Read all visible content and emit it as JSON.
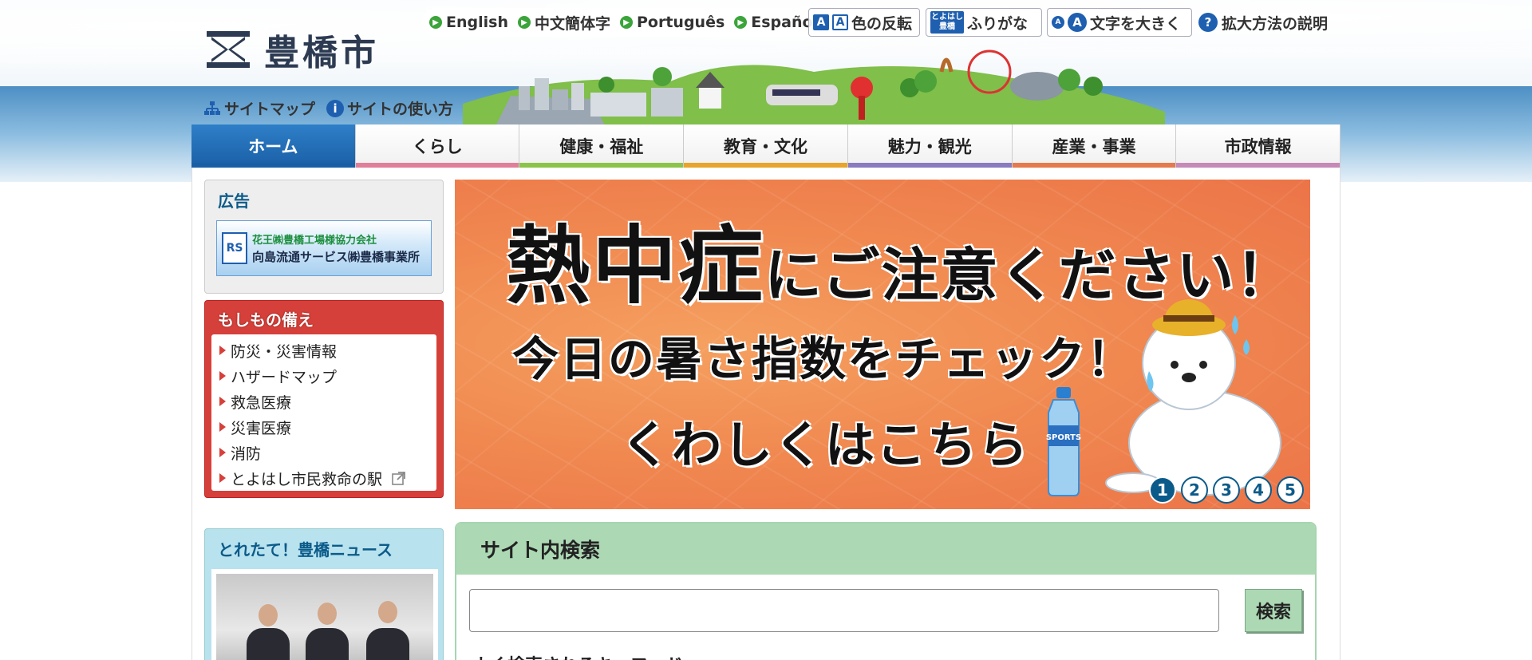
{
  "site": {
    "logo_text": "豊橋市"
  },
  "languages": [
    "English",
    "中文簡体字",
    "Português",
    "Español"
  ],
  "tools": {
    "color_invert": "色の反転",
    "furigana_badge_line1": "とよはし",
    "furigana_badge_line2": "豊橋",
    "furigana": "ふりがな",
    "text_large": "文字を大きく",
    "zoom_help": "拡大方法の説明"
  },
  "sublinks": {
    "sitemap": "サイトマップ",
    "how_to_use": "サイトの使い方"
  },
  "nav": [
    {
      "label": "ホーム",
      "color": "#1a5fa6"
    },
    {
      "label": "くらし",
      "color": "#e07f9a"
    },
    {
      "label": "健康・福祉",
      "color": "#8cc34a"
    },
    {
      "label": "教育・文化",
      "color": "#e9a42c"
    },
    {
      "label": "魅力・観光",
      "color": "#8a7bc0"
    },
    {
      "label": "産業・事業",
      "color": "#e57a4e"
    },
    {
      "label": "市政情報",
      "color": "#c58ab8"
    }
  ],
  "ad": {
    "title": "広告",
    "logo": "RS",
    "line1": "花王㈱豊橋工場様協力会社",
    "line2": "向島流通サービス㈱豊橋事業所"
  },
  "disaster": {
    "title": "もしもの備え",
    "items": [
      "防災・災害情報",
      "ハザードマップ",
      "救急医療",
      "災害医療",
      "消防",
      "とよはし市民救命の駅"
    ]
  },
  "news": {
    "title": "とれたて！豊橋ニュース"
  },
  "banner": {
    "line1_big": "熱中症",
    "line1_rest": "にご注意ください！",
    "line2": "今日の暑さ指数をチェック！",
    "line3": "くわしくはこちら",
    "bottle_label": "SPORTS",
    "pages": [
      "1",
      "2",
      "3",
      "4",
      "5"
    ],
    "active_page": "1"
  },
  "search": {
    "title": "サイト内検索",
    "placeholder": "",
    "button": "検索",
    "keywords_title": "よく検索されるキーワード"
  },
  "colors": {
    "accent_blue": "#1a5fa6",
    "disaster_red": "#d6403a",
    "search_green": "#acd8b4",
    "banner_orange": "#f08850"
  }
}
